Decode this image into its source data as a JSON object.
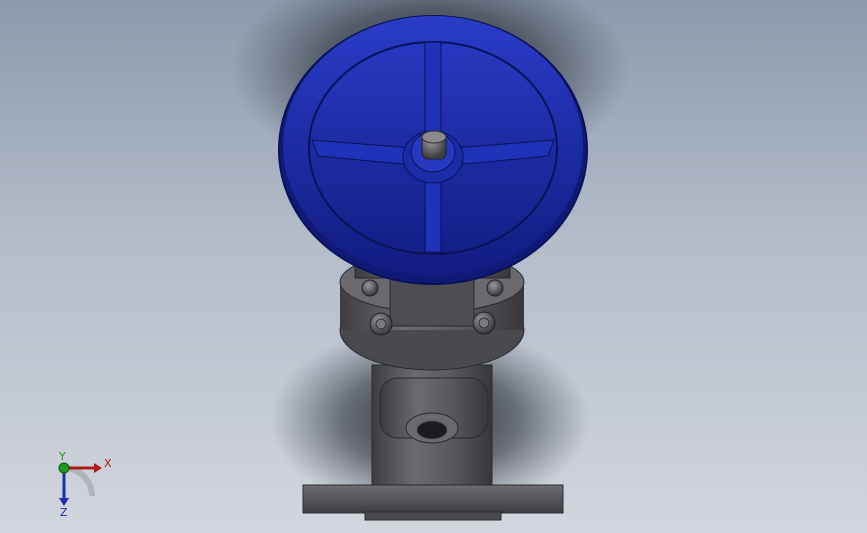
{
  "viewport": {
    "background_top": "#8d9aae",
    "background_bottom": "#d2d6dd"
  },
  "model": {
    "handwheel_color": "#1a2fa8",
    "body_color": "#5a5a5e"
  },
  "triad": {
    "x_label": "X",
    "y_label": "Y",
    "z_label": "Z",
    "x_color": "#b01818",
    "y_color": "#1a9a1a",
    "z_color": "#1a2fa8"
  }
}
